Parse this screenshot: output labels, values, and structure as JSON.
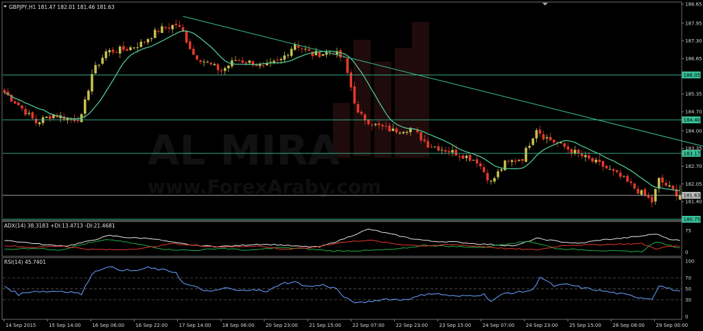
{
  "chart_data": [
    {
      "type": "candlestick",
      "header": "GBPJPY,H1  181.47 182.01 181.46 181.63",
      "symbol": "GBPJPY",
      "timeframe": "H1",
      "ohlc_last": {
        "open": 181.47,
        "high": 182.01,
        "low": 181.46,
        "close": 181.63
      },
      "ylim": [
        180.75,
        188.65
      ],
      "y_ticks": [
        188.65,
        187.95,
        187.3,
        186.65,
        186.05,
        185.35,
        184.7,
        184.4,
        184.0,
        183.35,
        183.17,
        182.7,
        182.05,
        181.63,
        181.4,
        180.75
      ],
      "x_labels": [
        "14 Sep 2015",
        "15 Sep 14:00",
        "16 Sep 06:00",
        "16 Sep 22:00",
        "17 Sep 14:00",
        "18 Sep 06:00",
        "20 Sep 23:00",
        "21 Sep 15:00",
        "22 Sep 07:00",
        "22 Sep 23:00",
        "23 Sep 15:00",
        "24 Sep 07:00",
        "24 Sep 23:00",
        "25 Sep 15:00",
        "28 Sep 08:00",
        "29 Sep 00:00"
      ],
      "horizontal_levels": [
        {
          "value": 186.05,
          "color": "#39c29a"
        },
        {
          "value": 184.4,
          "color": "#39c29a"
        },
        {
          "value": 183.17,
          "color": "#39c29a"
        },
        {
          "value": 181.63,
          "color": "#bdbdbd"
        },
        {
          "value": 180.75,
          "color": "#39c29a"
        }
      ],
      "trendline": {
        "from": {
          "x_index": 51,
          "y": 188.2
        },
        "to": {
          "x_index": 210,
          "y": 183.1
        },
        "color": "#39c29a"
      },
      "moving_average_color": "#4fc995",
      "bull_color": "#c8c050",
      "bear_color": "#e53a2b",
      "path_anchors": [
        [
          0,
          185.4
        ],
        [
          4,
          184.95
        ],
        [
          9,
          184.3
        ],
        [
          14,
          184.6
        ],
        [
          19,
          184.4
        ],
        [
          22,
          184.5
        ],
        [
          25,
          186.1
        ],
        [
          29,
          186.9
        ],
        [
          35,
          187.0
        ],
        [
          39,
          187.2
        ],
        [
          44,
          187.7
        ],
        [
          49,
          187.9
        ],
        [
          51,
          187.6
        ],
        [
          54,
          186.8
        ],
        [
          59,
          186.4
        ],
        [
          62,
          186.2
        ],
        [
          66,
          186.6
        ],
        [
          71,
          186.5
        ],
        [
          74,
          186.3
        ],
        [
          79,
          186.6
        ],
        [
          83,
          187.2
        ],
        [
          88,
          186.8
        ],
        [
          94,
          186.9
        ],
        [
          97,
          186.6
        ],
        [
          101,
          184.6
        ],
        [
          106,
          184.2
        ],
        [
          111,
          184.0
        ],
        [
          116,
          184.1
        ],
        [
          121,
          183.5
        ],
        [
          126,
          183.3
        ],
        [
          131,
          183.1
        ],
        [
          135,
          182.9
        ],
        [
          139,
          182.1
        ],
        [
          143,
          182.8
        ],
        [
          148,
          183.0
        ],
        [
          152,
          184.1
        ],
        [
          154,
          183.8
        ],
        [
          160,
          183.4
        ],
        [
          166,
          183.0
        ],
        [
          171,
          182.7
        ],
        [
          176,
          182.3
        ],
        [
          181,
          181.8
        ],
        [
          185,
          181.4
        ],
        [
          187,
          182.2
        ],
        [
          191,
          181.8
        ],
        [
          193,
          181.63
        ]
      ]
    },
    {
      "type": "line",
      "header": "ADX(14) 38.3183 +DI:13.4713 -DI:21.4681",
      "ylim": [
        0,
        100
      ],
      "y_ticks": [
        75,
        0
      ],
      "series": [
        {
          "name": "ADX",
          "color": "#e8e8e8",
          "anchors": [
            [
              0,
              42
            ],
            [
              6,
              34
            ],
            [
              12,
              25
            ],
            [
              18,
              22
            ],
            [
              24,
              38
            ],
            [
              30,
              58
            ],
            [
              36,
              50
            ],
            [
              42,
              48
            ],
            [
              48,
              34
            ],
            [
              54,
              24
            ],
            [
              60,
              20
            ],
            [
              66,
              22
            ],
            [
              72,
              28
            ],
            [
              78,
              26
            ],
            [
              84,
              20
            ],
            [
              90,
              18
            ],
            [
              96,
              42
            ],
            [
              104,
              80
            ],
            [
              110,
              64
            ],
            [
              116,
              48
            ],
            [
              122,
              38
            ],
            [
              128,
              36
            ],
            [
              134,
              30
            ],
            [
              140,
              26
            ],
            [
              146,
              22
            ],
            [
              152,
              48
            ],
            [
              158,
              38
            ],
            [
              164,
              30
            ],
            [
              170,
              42
            ],
            [
              176,
              48
            ],
            [
              182,
              56
            ],
            [
              186,
              64
            ],
            [
              190,
              46
            ],
            [
              193,
              40
            ]
          ]
        },
        {
          "name": "+DI",
          "color": "#21b04a",
          "anchors": [
            [
              0,
              10
            ],
            [
              8,
              14
            ],
            [
              16,
              8
            ],
            [
              24,
              32
            ],
            [
              30,
              44
            ],
            [
              38,
              28
            ],
            [
              46,
              10
            ],
            [
              54,
              6
            ],
            [
              62,
              14
            ],
            [
              70,
              6
            ],
            [
              78,
              16
            ],
            [
              86,
              12
            ],
            [
              94,
              4
            ],
            [
              104,
              6
            ],
            [
              112,
              10
            ],
            [
              120,
              24
            ],
            [
              128,
              20
            ],
            [
              136,
              16
            ],
            [
              144,
              30
            ],
            [
              150,
              38
            ],
            [
              158,
              12
            ],
            [
              166,
              8
            ],
            [
              174,
              4
            ],
            [
              182,
              2
            ],
            [
              186,
              36
            ],
            [
              190,
              24
            ],
            [
              193,
              14
            ]
          ]
        },
        {
          "name": "-DI",
          "color": "#e53a2b",
          "anchors": [
            [
              0,
              24
            ],
            [
              8,
              16
            ],
            [
              16,
              22
            ],
            [
              24,
              10
            ],
            [
              32,
              8
            ],
            [
              40,
              14
            ],
            [
              48,
              30
            ],
            [
              56,
              22
            ],
            [
              64,
              18
            ],
            [
              72,
              22
            ],
            [
              80,
              10
            ],
            [
              88,
              16
            ],
            [
              96,
              34
            ],
            [
              104,
              42
            ],
            [
              112,
              28
            ],
            [
              120,
              22
            ],
            [
              128,
              26
            ],
            [
              136,
              20
            ],
            [
              144,
              12
            ],
            [
              152,
              8
            ],
            [
              160,
              24
            ],
            [
              168,
              26
            ],
            [
              176,
              28
            ],
            [
              182,
              30
            ],
            [
              186,
              12
            ],
            [
              190,
              20
            ],
            [
              193,
              21
            ]
          ]
        }
      ]
    },
    {
      "type": "line",
      "header": "RSI(14) 45.7401",
      "ylim": [
        0,
        100
      ],
      "y_ticks": [
        100,
        70,
        50,
        30,
        0
      ],
      "levels": [
        70,
        50,
        30
      ],
      "series": [
        {
          "name": "RSI",
          "color": "#5b8de0",
          "anchors": [
            [
              0,
              55
            ],
            [
              4,
              40
            ],
            [
              8,
              46
            ],
            [
              12,
              45
            ],
            [
              16,
              46
            ],
            [
              20,
              44
            ],
            [
              22,
              40
            ],
            [
              25,
              78
            ],
            [
              29,
              90
            ],
            [
              33,
              85
            ],
            [
              37,
              82
            ],
            [
              41,
              88
            ],
            [
              45,
              84
            ],
            [
              49,
              80
            ],
            [
              51,
              60
            ],
            [
              55,
              52
            ],
            [
              59,
              44
            ],
            [
              63,
              52
            ],
            [
              67,
              46
            ],
            [
              71,
              50
            ],
            [
              75,
              44
            ],
            [
              79,
              60
            ],
            [
              83,
              62
            ],
            [
              87,
              54
            ],
            [
              91,
              57
            ],
            [
              95,
              50
            ],
            [
              97,
              34
            ],
            [
              101,
              24
            ],
            [
              105,
              28
            ],
            [
              109,
              32
            ],
            [
              113,
              30
            ],
            [
              117,
              34
            ],
            [
              121,
              42
            ],
            [
              125,
              40
            ],
            [
              129,
              36
            ],
            [
              133,
              38
            ],
            [
              137,
              40
            ],
            [
              139,
              28
            ],
            [
              143,
              42
            ],
            [
              147,
              44
            ],
            [
              151,
              48
            ],
            [
              153,
              72
            ],
            [
              157,
              55
            ],
            [
              161,
              58
            ],
            [
              165,
              52
            ],
            [
              169,
              48
            ],
            [
              173,
              44
            ],
            [
              177,
              40
            ],
            [
              181,
              35
            ],
            [
              185,
              32
            ],
            [
              187,
              56
            ],
            [
              190,
              50
            ],
            [
              193,
              45.74
            ]
          ]
        }
      ]
    }
  ]
}
